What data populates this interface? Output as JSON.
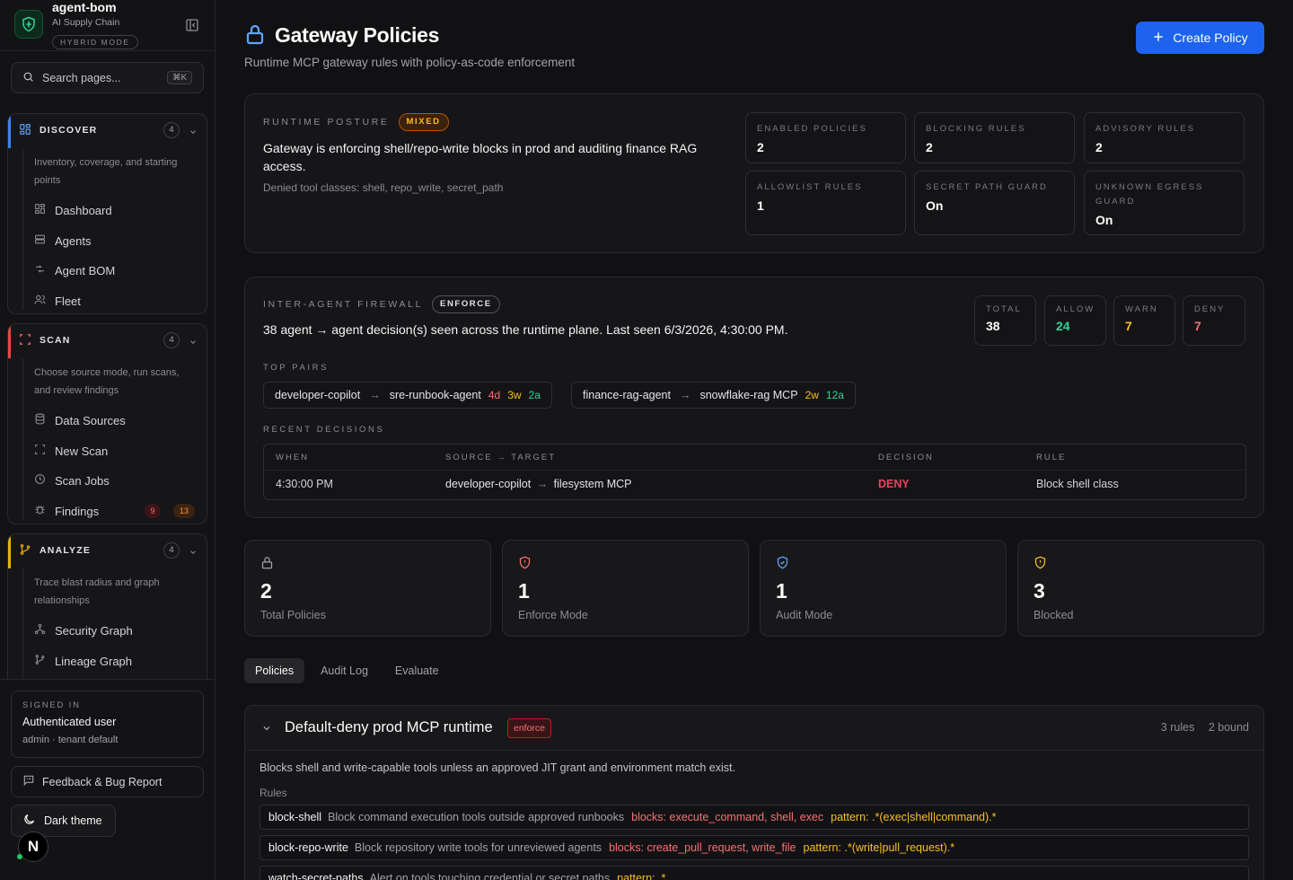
{
  "brand": {
    "name": "agent-bom",
    "subtitle": "AI Supply Chain",
    "mode": "HYBRID MODE"
  },
  "search": {
    "placeholder": "Search pages...",
    "shortcut": "⌘K"
  },
  "nav": {
    "discover": {
      "title": "DISCOVER",
      "count": "4",
      "accent": "#3b82f6",
      "description": "Inventory, coverage, and starting points",
      "items": [
        {
          "label": "Dashboard",
          "icon": "dashboard-icon"
        },
        {
          "label": "Agents",
          "icon": "server-icon"
        },
        {
          "label": "Agent BOM",
          "icon": "workflow-icon"
        },
        {
          "label": "Fleet",
          "icon": "users-icon"
        }
      ]
    },
    "scan": {
      "title": "SCAN",
      "count": "4",
      "accent": "#ef4444",
      "description": "Choose source mode, run scans, and review findings",
      "items": [
        {
          "label": "Data Sources",
          "icon": "database-icon"
        },
        {
          "label": "New Scan",
          "icon": "scan-icon"
        },
        {
          "label": "Scan Jobs",
          "icon": "clock-icon"
        },
        {
          "label": "Findings",
          "icon": "bug-icon",
          "badge_critical": "9",
          "badge_high": "13"
        }
      ]
    },
    "analyze": {
      "title": "ANALYZE",
      "count": "4",
      "accent": "#eab308",
      "description": "Trace blast radius and graph relationships",
      "items": [
        {
          "label": "Security Graph",
          "icon": "graph-icon"
        },
        {
          "label": "Lineage Graph",
          "icon": "lineage-icon"
        }
      ]
    }
  },
  "user": {
    "heading": "SIGNED IN",
    "name": "Authenticated user",
    "role": "admin · tenant default"
  },
  "feedback_label": "Feedback & Bug Report",
  "theme_label": "Dark theme",
  "next_logo": "N",
  "page": {
    "title": "Gateway Policies",
    "subtitle": "Runtime MCP gateway rules with policy-as-code enforcement",
    "create_label": "Create Policy"
  },
  "posture": {
    "eyebrow": "RUNTIME POSTURE",
    "status": "MIXED",
    "summary": "Gateway is enforcing shell/repo-write blocks in prod and auditing finance RAG access.",
    "denied": "Denied tool classes: shell, repo_write, secret_path",
    "stats": [
      {
        "label": "ENABLED POLICIES",
        "value": "2"
      },
      {
        "label": "BLOCKING RULES",
        "value": "2"
      },
      {
        "label": "ADVISORY RULES",
        "value": "2"
      },
      {
        "label": "ALLOWLIST RULES",
        "value": "1"
      },
      {
        "label": "SECRET PATH GUARD",
        "value": "On"
      },
      {
        "label": "UNKNOWN EGRESS GUARD",
        "value": "On"
      }
    ]
  },
  "firewall": {
    "eyebrow": "INTER-AGENT FIREWALL",
    "status": "ENFORCE",
    "summary": "38 agent → agent decision(s) seen across the runtime plane. Last seen 6/3/2026, 4:30:00 PM.",
    "totals": [
      {
        "label": "TOTAL",
        "value": "38",
        "color": "#fafafa"
      },
      {
        "label": "ALLOW",
        "value": "24",
        "color": "#34d399"
      },
      {
        "label": "WARN",
        "value": "7",
        "color": "#fbbf24"
      },
      {
        "label": "DENY",
        "value": "7",
        "color": "#f87171"
      }
    ],
    "top_pairs_label": "TOP PAIRS",
    "pairs": [
      {
        "source": "developer-copilot",
        "target": "sre-runbook-agent",
        "deny": "4d",
        "warn": "3w",
        "allow": "2a"
      },
      {
        "source": "finance-rag-agent",
        "target": "snowflake-rag MCP",
        "warn": "2w",
        "allow": "12a"
      }
    ],
    "recent_label": "RECENT DECISIONS",
    "columns": [
      "WHEN",
      "SOURCE → TARGET",
      "DECISION",
      "RULE"
    ],
    "rows": [
      {
        "when": "4:30:00 PM",
        "source": "developer-copilot",
        "target": "filesystem MCP",
        "decision": "DENY",
        "rule": "Block shell class"
      }
    ]
  },
  "metrics": [
    {
      "value": "2",
      "label": "Total Policies",
      "icon": "lock-icon",
      "color": "#a1a1aa"
    },
    {
      "value": "1",
      "label": "Enforce Mode",
      "icon": "shield-alert-icon",
      "color": "#f87171"
    },
    {
      "value": "1",
      "label": "Audit Mode",
      "icon": "shield-check-icon",
      "color": "#60a5fa"
    },
    {
      "value": "3",
      "label": "Blocked",
      "icon": "shield-warning-icon",
      "color": "#fbbf24"
    }
  ],
  "tabs": [
    "Policies",
    "Audit Log",
    "Evaluate"
  ],
  "policy": {
    "title": "Default-deny prod MCP runtime",
    "mode": "enforce",
    "rules_count": "3 rules",
    "bound_count": "2 bound",
    "description": "Blocks shell and write-capable tools unless an approved JIT grant and environment match exist.",
    "rules_label": "Rules",
    "rules": [
      {
        "name": "block-shell",
        "desc": "Block command execution tools outside approved runbooks",
        "blocks": "blocks: execute_command, shell, exec",
        "pattern": "pattern: .*(exec|shell|command).*"
      },
      {
        "name": "block-repo-write",
        "desc": "Block repository write tools for unreviewed agents",
        "blocks": "blocks: create_pull_request, write_file",
        "pattern": "pattern: .*(write|pull_request).*"
      },
      {
        "name": "watch-secret-paths",
        "desc": "Alert on tools touching credential or secret paths",
        "blocks": "",
        "pattern": "pattern: .*"
      }
    ]
  }
}
